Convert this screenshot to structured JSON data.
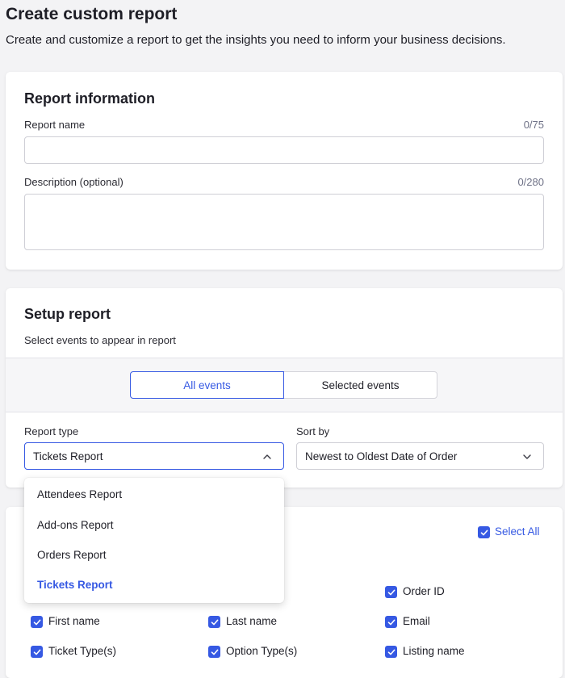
{
  "page": {
    "title": "Create custom report",
    "subtitle": "Create and customize a report to get the insights you need to inform your business decisions."
  },
  "report_info": {
    "title": "Report information",
    "name_label": "Report name",
    "name_counter": "0/75",
    "name_value": "",
    "description_label": "Description (optional)",
    "description_counter": "0/280",
    "description_value": ""
  },
  "setup": {
    "title": "Setup report",
    "events_label": "Select events to appear in report",
    "segments": [
      "All events",
      "Selected events"
    ],
    "selected_segment": "All events",
    "report_type_label": "Report type",
    "report_type_value": "Tickets Report",
    "sort_label": "Sort by",
    "sort_value": "Newest to Oldest Date of Order"
  },
  "report_type_options": [
    "Attendees Report",
    "Add-ons Report",
    "Orders Report",
    "Tickets Report"
  ],
  "fields": {
    "select_all_label": "Select All",
    "items": [
      {
        "label": "Order ID",
        "checked": true
      },
      {
        "label": "First name",
        "checked": true
      },
      {
        "label": "Last name",
        "checked": true
      },
      {
        "label": "Email",
        "checked": true
      },
      {
        "label": "Ticket Type(s)",
        "checked": true
      },
      {
        "label": "Option Type(s)",
        "checked": true
      },
      {
        "label": "Listing name",
        "checked": true
      }
    ]
  },
  "colors": {
    "accent": "#3659e3",
    "background": "#f3f3f5",
    "text": "#1e1e26",
    "muted": "#6f7287"
  }
}
